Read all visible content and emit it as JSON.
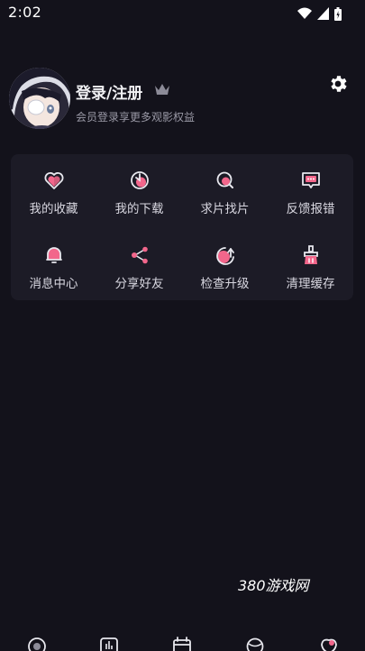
{
  "status_bar": {
    "time": "2:02",
    "icons": [
      "wifi-icon",
      "signal-icon",
      "battery-icon"
    ]
  },
  "profile": {
    "avatar_icon": "anime-avatar",
    "title": "登录/注册",
    "crown_icon": "crown-icon",
    "subtitle": "会员登录享更多观影权益",
    "settings_icon": "gear-icon"
  },
  "menu": {
    "items": [
      {
        "label": "我的收藏",
        "icon": "heart-icon"
      },
      {
        "label": "我的下载",
        "icon": "download-icon"
      },
      {
        "label": "求片找片",
        "icon": "search-film-icon"
      },
      {
        "label": "反馈报错",
        "icon": "feedback-icon"
      },
      {
        "label": "消息中心",
        "icon": "bell-icon"
      },
      {
        "label": "分享好友",
        "icon": "share-icon"
      },
      {
        "label": "检查升级",
        "icon": "upgrade-icon"
      },
      {
        "label": "清理缓存",
        "icon": "clean-icon"
      }
    ]
  },
  "watermark": "380游戏网",
  "bottom_nav": {
    "items": [
      "home-icon",
      "chart-icon",
      "calendar-icon",
      "discover-icon",
      "profile-icon"
    ]
  },
  "colors": {
    "background": "#13121b",
    "card": "#1c1b26",
    "accent_pink": "#f2668b",
    "icon_white": "#e8e8ee"
  }
}
